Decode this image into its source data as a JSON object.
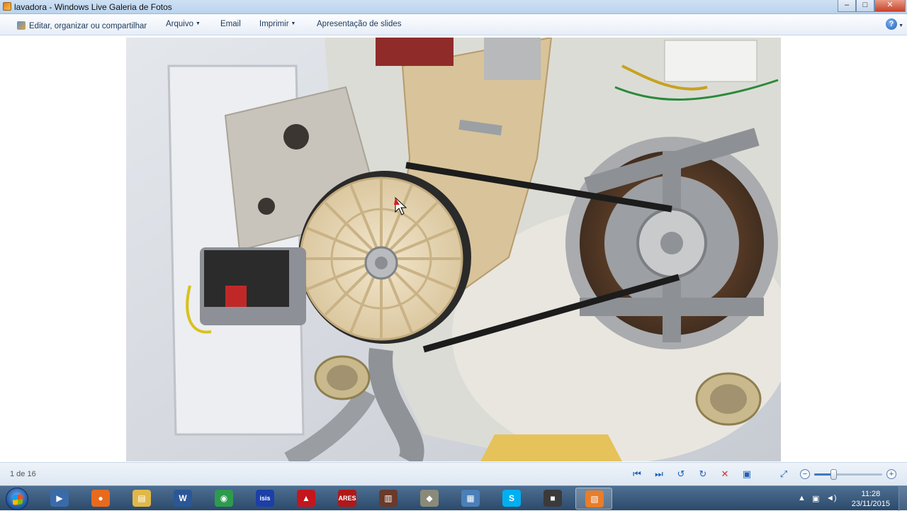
{
  "window": {
    "title": "lavadora - Windows Live Galeria de Fotos",
    "controls": {
      "minimize": "–",
      "maximize": "□",
      "close": "✕"
    }
  },
  "menu": {
    "items": [
      {
        "label": "Editar, organizar ou compartilhar",
        "icon": "edit-icon"
      },
      {
        "label": "Arquivo",
        "dropdown": true
      },
      {
        "label": "Email"
      },
      {
        "label": "Imprimir",
        "dropdown": true
      },
      {
        "label": "Apresentação de slides"
      }
    ],
    "help": "?"
  },
  "photo": {
    "subject": "washing machine motor, belt and pulley"
  },
  "navigation": {
    "counter": "1 de 16",
    "buttons": [
      {
        "name": "previous-icon",
        "glyph": "⏮"
      },
      {
        "name": "next-icon",
        "glyph": "⏭"
      },
      {
        "name": "rotate-left-icon",
        "glyph": "↺"
      },
      {
        "name": "rotate-right-icon",
        "glyph": "↻"
      },
      {
        "name": "delete-icon",
        "glyph": "✕"
      },
      {
        "name": "slideshow-icon",
        "glyph": "▣"
      }
    ],
    "fit_glyph": "⤢",
    "zoom_minus": "−",
    "zoom_plus": "+",
    "zoom_level": 0.28
  },
  "taskbar": {
    "apps": [
      {
        "name": "media-player-icon",
        "glyph": "▶",
        "color": "#3a6aa8"
      },
      {
        "name": "firefox-icon",
        "glyph": "●",
        "color": "#e86a1d"
      },
      {
        "name": "file-explorer-icon",
        "glyph": "▤",
        "color": "#e0b84a"
      },
      {
        "name": "word-icon",
        "glyph": "W",
        "color": "#2b5797"
      },
      {
        "name": "chrome-icon",
        "glyph": "◉",
        "color": "#2d9b4e"
      },
      {
        "name": "isis-icon",
        "glyph": "isis",
        "color": "#1c3fa8"
      },
      {
        "name": "acrobat-icon",
        "glyph": "▲",
        "color": "#c4161c"
      },
      {
        "name": "ares-icon",
        "glyph": "ARES",
        "color": "#b01818"
      },
      {
        "name": "book-reader-icon",
        "glyph": "▥",
        "color": "#6a3a2a"
      },
      {
        "name": "gimp-icon",
        "glyph": "◆",
        "color": "#8a8a7a"
      },
      {
        "name": "calculator-icon",
        "glyph": "▦",
        "color": "#4b7fb8"
      },
      {
        "name": "skype-icon",
        "glyph": "S",
        "color": "#00aff0"
      },
      {
        "name": "movie-maker-icon",
        "glyph": "■",
        "color": "#3a3a3a"
      },
      {
        "name": "photo-gallery-icon",
        "glyph": "▧",
        "color": "#e87d2a",
        "active": true
      }
    ],
    "tray": {
      "up_arrow": "▲",
      "network": "▣",
      "volume": "◄)",
      "time": "11:28",
      "date": "23/11/2015"
    }
  }
}
